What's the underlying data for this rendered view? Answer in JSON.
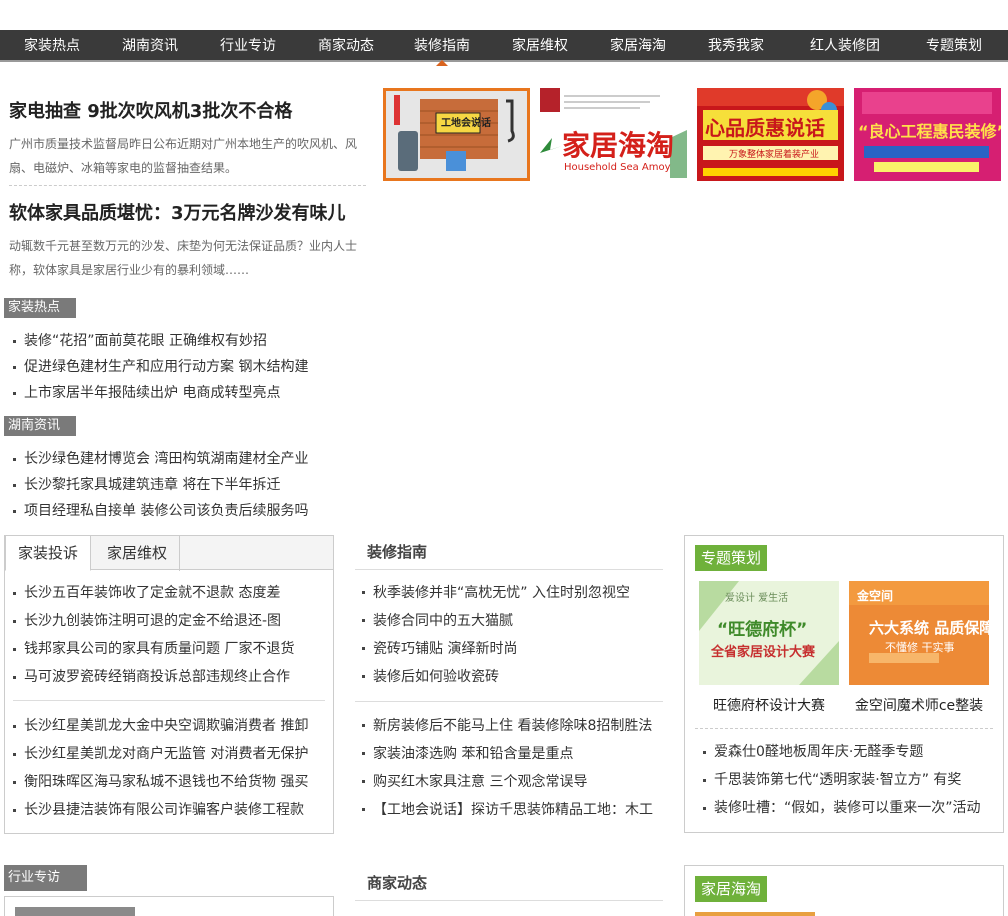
{
  "nav": [
    {
      "label": "家装热点"
    },
    {
      "label": "湖南资讯"
    },
    {
      "label": "行业专访"
    },
    {
      "label": "商家动态"
    },
    {
      "label": "装修指南"
    },
    {
      "label": "家居维权"
    },
    {
      "label": "家居海淘"
    },
    {
      "label": "我秀我家"
    },
    {
      "label": "红人装修团"
    },
    {
      "label": "专题策划"
    }
  ],
  "headlines": [
    {
      "title": "家电抽查 9批次吹风机3批次不合格",
      "summary": "广州市质量技术监督局昨日公布近期对广州本地生产的吹风机、风扇、电磁炉、冰箱等家电的监督抽查结果。"
    },
    {
      "title": "软体家具品质堪忧：3万元名牌沙发有味儿",
      "summary": "动辄数千元甚至数万元的沙发、床垫为何无法保证品质？业内人士称，软体家具是家居行业少有的暴利领域……"
    }
  ],
  "thumbs": [
    {
      "caption": "工地会说话",
      "bg": "#f2f2f2",
      "accent": "#c0392b"
    },
    {
      "caption": "家居海淘",
      "sub": "Household Sea Amoy",
      "bg": "#ffffff",
      "accent": "#d4201a"
    },
    {
      "caption": "心品质惠说话",
      "sub": "万象整体家居着装产业",
      "bg": "#c8171b",
      "accent": "#ffd200"
    },
    {
      "caption": "“良心工程惠民装修”",
      "bg": "#d61f72",
      "accent": "#ffe14a"
    }
  ],
  "sections": {
    "jiazhuang": {
      "label": "家装热点",
      "items": [
        "装修“花招”面前莫花眼 正确维权有妙招",
        "促进绿色建材生产和应用行动方案 钢木结构建",
        "上市家居半年报陆续出炉 电商成转型亮点"
      ]
    },
    "hunan": {
      "label": "湖南资讯",
      "items": [
        "长沙绿色建材博览会 湾田构筑湖南建材全产业",
        "长沙黎托家具城建筑违章 将在下半年拆迁",
        "项目经理私自接单 装修公司该负责后续服务吗"
      ]
    }
  },
  "complaints": {
    "tabs": [
      {
        "label": "家装投诉"
      },
      {
        "label": "家居维权"
      }
    ],
    "group1": [
      "长沙五百年装饰收了定金就不退款 态度差",
      "长沙九创装饰注明可退的定金不给退还-图",
      "钱邦家具公司的家具有质量问题 厂家不退货",
      "马可波罗瓷砖经销商投诉总部违规终止合作"
    ],
    "group2": [
      "长沙红星美凯龙大金中央空调欺骗消费者 推卸",
      "长沙红星美凯龙对商户无监管 对消费者无保护",
      "衡阳珠晖区海马家私城不退钱也不给货物 强买",
      "长沙县捷洁装饰有限公司诈骗客户装修工程款"
    ]
  },
  "guide": {
    "title": "装修指南",
    "group1": [
      "秋季装修并非“高枕无忧” 入住时别忽视空",
      "装修合同中的五大猫腻",
      "瓷砖巧铺贴 演绎新时尚",
      "装修后如何验收瓷砖"
    ],
    "group2": [
      "新房装修后不能马上住 看装修除味8招制胜法",
      "家装油漆选购 苯和铅含量是重点",
      "购买红木家具注意 三个观念常误导",
      "【工地会说话】探访千思装饰精品工地：木工"
    ]
  },
  "special": {
    "label": "专题策划",
    "promos": [
      {
        "caption": "旺德府杯设计大赛",
        "headline": "“旺德府杯”",
        "sub": "全省家居设计大赛",
        "top": "爱设计 爱生活"
      },
      {
        "caption": "金空间魔术师ce整装",
        "headline": "六大系统 品质保障",
        "sub": "不懂修 干实事",
        "top": "金空间"
      }
    ],
    "items": [
      "爱森仕0醛地板周年庆·无醛季专题",
      "千思装饰第七代“透明家装·智立方” 有奖",
      "装修吐槽：“假如，装修可以重来一次”活动"
    ]
  },
  "bottom": {
    "industry_label": "行业专访",
    "merchant_title": "商家动态",
    "overseas_label": "家居海淘"
  },
  "colors": {
    "nav_bg": "#3a3a3a",
    "accent_green": "#6fb13b",
    "label_gray": "#7a7a7a",
    "active_marker": "#d9641f"
  }
}
